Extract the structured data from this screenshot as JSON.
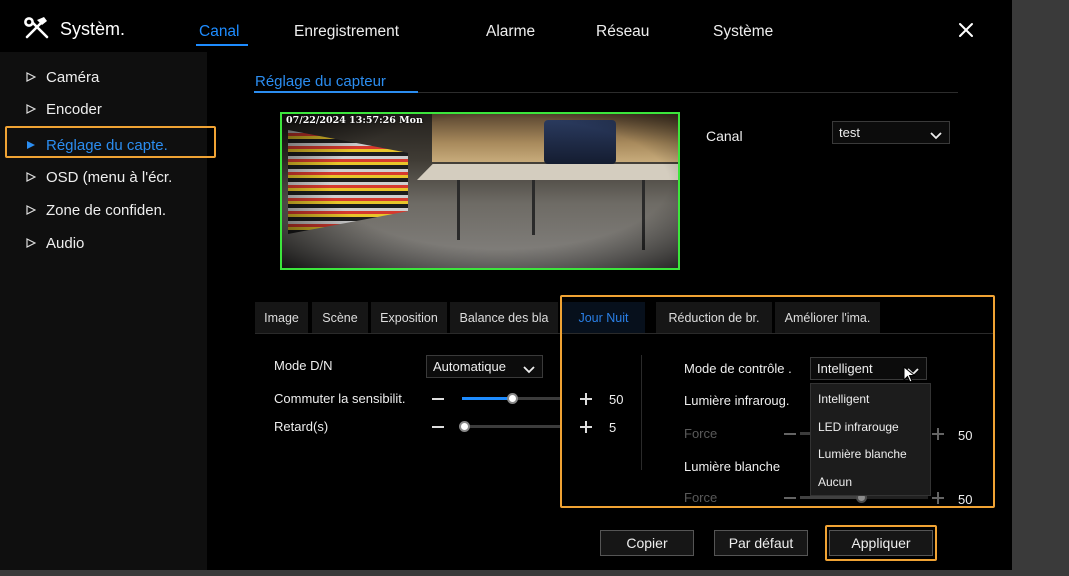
{
  "app": {
    "title": "Systèm.",
    "logo_icon": "tools-icon",
    "close_icon": "close-icon"
  },
  "nav": [
    {
      "label": "Canal",
      "active": true
    },
    {
      "label": "Enregistrement",
      "active": false
    },
    {
      "label": "Alarme",
      "active": false
    },
    {
      "label": "Réseau",
      "active": false
    },
    {
      "label": "Système",
      "active": false
    }
  ],
  "sidebar": [
    {
      "label": "Caméra",
      "active": false
    },
    {
      "label": "Encoder",
      "active": false
    },
    {
      "label": "Réglage du capte.",
      "active": true
    },
    {
      "label": "OSD (menu à l'écr.",
      "active": false
    },
    {
      "label": "Zone de confiden.",
      "active": false
    },
    {
      "label": "Audio",
      "active": false
    }
  ],
  "page": {
    "title": "Réglage du capteur"
  },
  "preview": {
    "timestamp": "07/22/2024 13:57:26 Mon"
  },
  "channel": {
    "label": "Canal",
    "value": "test"
  },
  "tabs": [
    {
      "label": "Image",
      "active": false
    },
    {
      "label": "Scène",
      "active": false
    },
    {
      "label": "Exposition",
      "active": false
    },
    {
      "label": "Balance des bla",
      "active": false
    },
    {
      "label": "Jour Nuit",
      "active": true
    },
    {
      "label": "Réduction de br.",
      "active": false
    },
    {
      "label": "Améliorer l'ima.",
      "active": false
    }
  ],
  "day_night": {
    "mode": {
      "label": "Mode D/N",
      "value": "Automatique"
    },
    "sensitivity": {
      "label": "Commuter la sensibilit.",
      "value": "50",
      "fill": 0.5
    },
    "delay": {
      "label": "Retard(s)",
      "value": "5",
      "fill": 0.02
    },
    "control_mode": {
      "label": "Mode de contrôle .",
      "value": "Intelligent",
      "options": [
        "Intelligent",
        "LED infrarouge",
        "Lumière blanche",
        "Aucun"
      ]
    },
    "ir_light": {
      "label": "Lumière infraroug.",
      "force_label": "Force",
      "force_value": "50"
    },
    "white_light": {
      "label": "Lumière blanche",
      "force_label": "Force",
      "force_value": "50",
      "fill": 0.48
    }
  },
  "buttons": {
    "copy": "Copier",
    "default": "Par défaut",
    "apply": "Appliquer"
  },
  "colors": {
    "accent": "#1e8cff",
    "highlight": "#f0a334",
    "preview_border": "#3ce63c",
    "background": "#000000"
  }
}
